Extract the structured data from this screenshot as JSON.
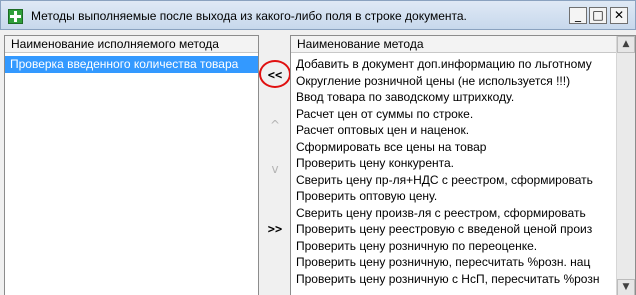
{
  "window": {
    "title": "Методы выполняемые после выхода из какого-либо поля в строке  документа.",
    "icon": "app-plus-icon",
    "controls": {
      "minimize": "_",
      "maximize": "□",
      "close": "✕"
    }
  },
  "left_list": {
    "header": "Наименование исполняемого метода",
    "items": [
      "Проверка введенного количества товара"
    ],
    "selected_index": 0
  },
  "buttons": {
    "move_left": "<<",
    "up": "^",
    "down": "v",
    "move_right": ">>"
  },
  "right_list": {
    "header": "Наименование метода",
    "items": [
      "Добавить в документ доп.информацию по льготному",
      "Округление розничной цены (не используется !!!)",
      "Ввод товара по заводскому штрихкоду.",
      "Расчет цен от суммы по строке.",
      "Расчет оптовых цен и наценок.",
      "Сформировать все цены на товар",
      "Проверить цену конкурента.",
      "Сверить цену пр-ля+НДС с реестром, сформировать",
      "Проверить оптовую цену.",
      "Сверить цену произв-ля с реестром, сформировать",
      "Проверить цену реестровую с введеной ценой произ",
      "Проверить цену розничную по переоценке.",
      "Проверить цену розничную, пересчитать %розн. нац",
      "Проверить цену розничную с НсП, пересчитать %розн"
    ]
  },
  "scrollbar": {
    "up_arrow": "▲",
    "down_arrow": "▼"
  },
  "colors": {
    "selection": "#3399ff",
    "highlight_ring": "#e01010"
  }
}
